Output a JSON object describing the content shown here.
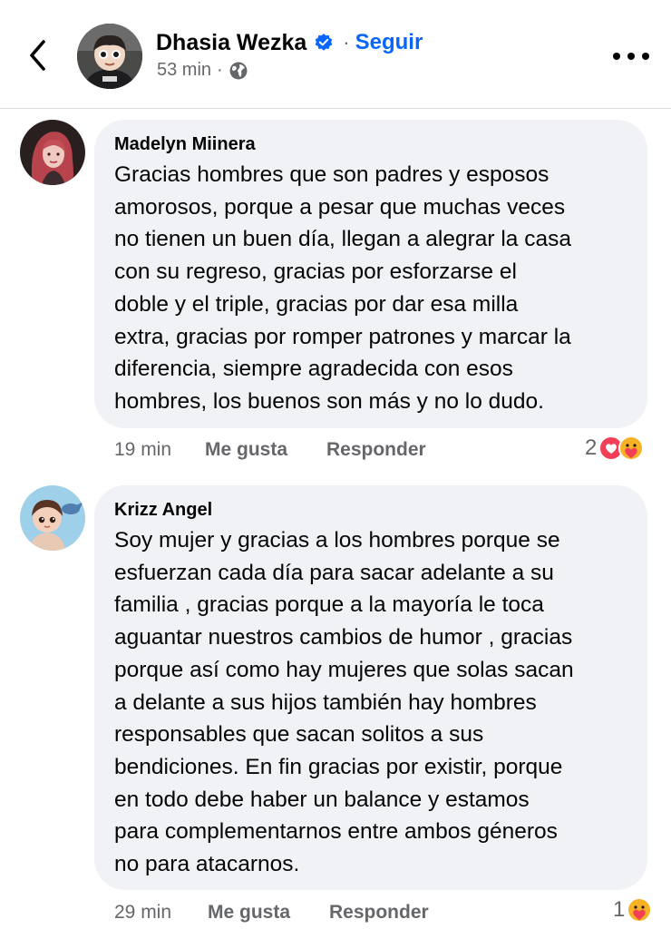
{
  "post": {
    "author": "Dhasia Wezka",
    "follow_label": "Seguir",
    "time": "53 min",
    "sep": "·"
  },
  "comments": [
    {
      "author": "Madelyn Miinera",
      "lines": [
        "Gracias hombres que son padres y esposos",
        "amorosos, porque a pesar que muchas veces",
        "no tienen un buen día, llegan a alegrar la casa",
        "con su regreso, gracias por esforzarse el",
        "doble y el triple, gracias por dar esa milla",
        "extra, gracias por romper patrones y marcar la",
        "diferencia, siempre agradecida con esos",
        "hombres, los buenos son más y no lo dudo."
      ],
      "time": "19 min",
      "like_label": "Me gusta",
      "reply_label": "Responder",
      "reaction_count": "2",
      "reaction_icons": [
        "heart-icon",
        "care-icon"
      ]
    },
    {
      "author": "Krizz Angel",
      "lines": [
        "Soy mujer y gracias a los hombres porque se",
        "esfuerzan cada día para sacar adelante a su",
        "familia , gracias porque a la mayoría le toca",
        "aguantar nuestros cambios de humor , gracias",
        "porque así como hay mujeres que solas sacan",
        "a delante a sus hijos también hay hombres",
        "responsables que sacan solitos a sus",
        "bendiciones. En fin gracias por existir, porque",
        "en todo debe haber un balance y estamos",
        "para complementarnos entre ambos géneros",
        "no para atacarnos."
      ],
      "time": "29 min",
      "like_label": "Me gusta",
      "reply_label": "Responder",
      "reaction_count": "1",
      "reaction_icons": [
        "care-icon"
      ]
    }
  ],
  "colors": {
    "accent": "#0866ff",
    "bubble": "#f0f2f5",
    "secondary_text": "#65676b",
    "heart": "#f33e58",
    "care": "#f7b125"
  }
}
